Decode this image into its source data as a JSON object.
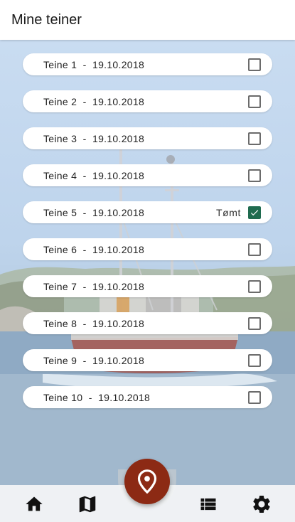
{
  "app": {
    "title": "Mine teiner"
  },
  "traps": [
    {
      "name": "Teine 1",
      "date": "19.10.2018",
      "emptied": false,
      "emptied_label": ""
    },
    {
      "name": "Teine 2",
      "date": "19.10.2018",
      "emptied": false,
      "emptied_label": ""
    },
    {
      "name": "Teine 3",
      "date": "19.10.2018",
      "emptied": false,
      "emptied_label": ""
    },
    {
      "name": "Teine 4",
      "date": "19.10.2018",
      "emptied": false,
      "emptied_label": ""
    },
    {
      "name": "Teine 5",
      "date": "19.10.2018",
      "emptied": true,
      "emptied_label": "Tømt"
    },
    {
      "name": "Teine 6",
      "date": "19.10.2018",
      "emptied": false,
      "emptied_label": ""
    },
    {
      "name": "Teine 7",
      "date": "19.10.2018",
      "emptied": false,
      "emptied_label": ""
    },
    {
      "name": "Teine 8",
      "date": "19.10.2018",
      "emptied": false,
      "emptied_label": ""
    },
    {
      "name": "Teine 9",
      "date": "19.10.2018",
      "emptied": false,
      "emptied_label": ""
    },
    {
      "name": "Teine 10",
      "date": "19.10.2018",
      "emptied": false,
      "emptied_label": ""
    }
  ],
  "separator": "  -  ",
  "bottom_nav": {
    "items": [
      {
        "icon": "home-icon"
      },
      {
        "icon": "map-icon"
      },
      {
        "icon": "location-pin-icon"
      },
      {
        "icon": "list-icon"
      },
      {
        "icon": "gear-icon"
      }
    ]
  },
  "colors": {
    "accent": "#8c2a14",
    "checkbox_checked": "#1f6b4f",
    "appbar_bg": "#ffffff"
  }
}
